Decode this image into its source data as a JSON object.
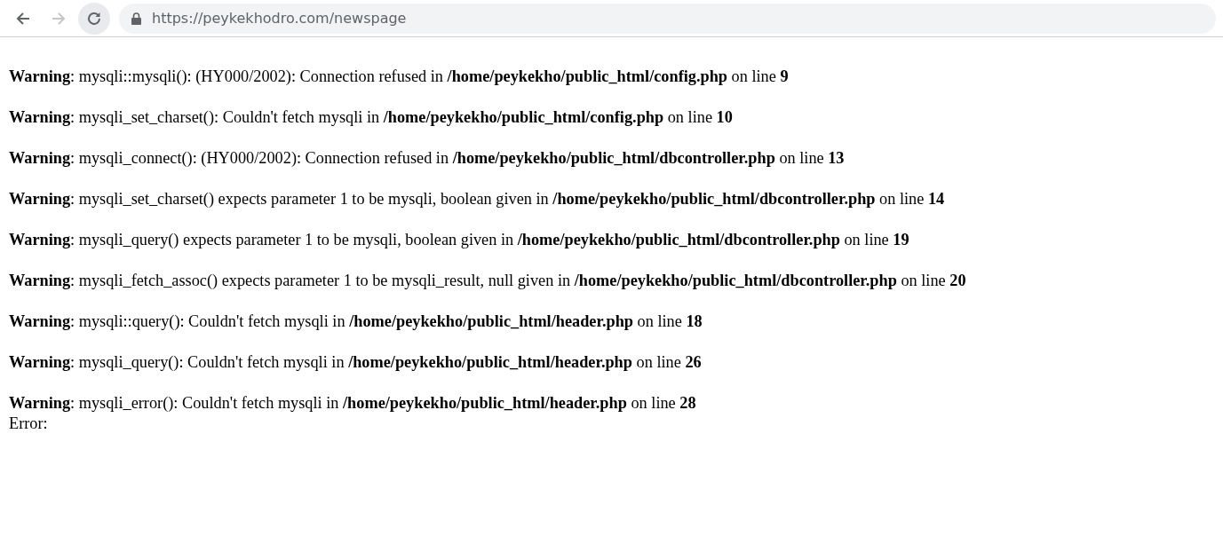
{
  "browser": {
    "back": {
      "disabled": false
    },
    "forward": {
      "disabled": true
    },
    "url": "https://peykekhodro.com/newspage"
  },
  "messages": [
    "**Warning**: mysqli::mysqli(): (HY000/2002): Connection refused in **/home/peykekho/public_html/config.php** on line **9**",
    "**Warning**: mysqli_set_charset(): Couldn't fetch mysqli in **/home/peykekho/public_html/config.php** on line **10**",
    "**Warning**: mysqli_connect(): (HY000/2002): Connection refused in **/home/peykekho/public_html/dbcontroller.php** on line **13**",
    "**Warning**: mysqli_set_charset() expects parameter 1 to be mysqli, boolean given in **/home/peykekho/public_html/dbcontroller.php** on line **14**",
    "**Warning**: mysqli_query() expects parameter 1 to be mysqli, boolean given in **/home/peykekho/public_html/dbcontroller.php** on line **19**",
    "**Warning**: mysqli_fetch_assoc() expects parameter 1 to be mysqli_result, null given in **/home/peykekho/public_html/dbcontroller.php** on line **20**",
    "**Warning**: mysqli::query(): Couldn't fetch mysqli in **/home/peykekho/public_html/header.php** on line **18**",
    "**Warning**: mysqli_query(): Couldn't fetch mysqli in **/home/peykekho/public_html/header.php** on line **26**",
    "**Warning**: mysqli_error(): Couldn't fetch mysqli in **/home/peykekho/public_html/header.php** on line **28**"
  ],
  "error_line": "Error:"
}
